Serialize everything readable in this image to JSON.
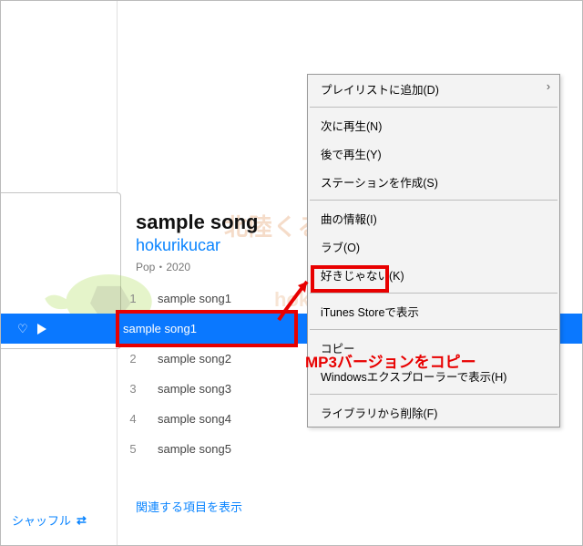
{
  "album": {
    "title": "sample song",
    "artist": "hokurikucar",
    "meta": "Pop・2020"
  },
  "tracks": [
    {
      "num": "1",
      "name": "sample song1"
    },
    {
      "num": "",
      "name": "sample song1",
      "selected": true
    },
    {
      "num": "2",
      "name": "sample song2"
    },
    {
      "num": "3",
      "name": "sample song3"
    },
    {
      "num": "4",
      "name": "sample song4"
    },
    {
      "num": "5",
      "name": "sample song5"
    }
  ],
  "related_link": "関連する項目を表示",
  "shuffle_label": "シャッフル",
  "context_menu": {
    "add_to_playlist": "プレイリストに追加(D)",
    "play_next": "次に再生(N)",
    "play_later": "後で再生(Y)",
    "create_station": "ステーションを作成(S)",
    "song_info": "曲の情報(I)",
    "love": "ラブ(O)",
    "dislike": "好きじゃない(K)",
    "show_in_store": "iTunes Storeで表示",
    "copy": "コピー",
    "show_in_explorer": "Windowsエクスプローラーで表示(H)",
    "delete_from_library": "ライブラリから削除(F)"
  },
  "callout_text": "MP3バージョンをコピー",
  "watermark": {
    "line1": "北陸くるま情報サイト",
    "line2": "hokurikucar.com"
  },
  "highlight_boxes": {
    "selected_row": true,
    "copy_item": true
  }
}
